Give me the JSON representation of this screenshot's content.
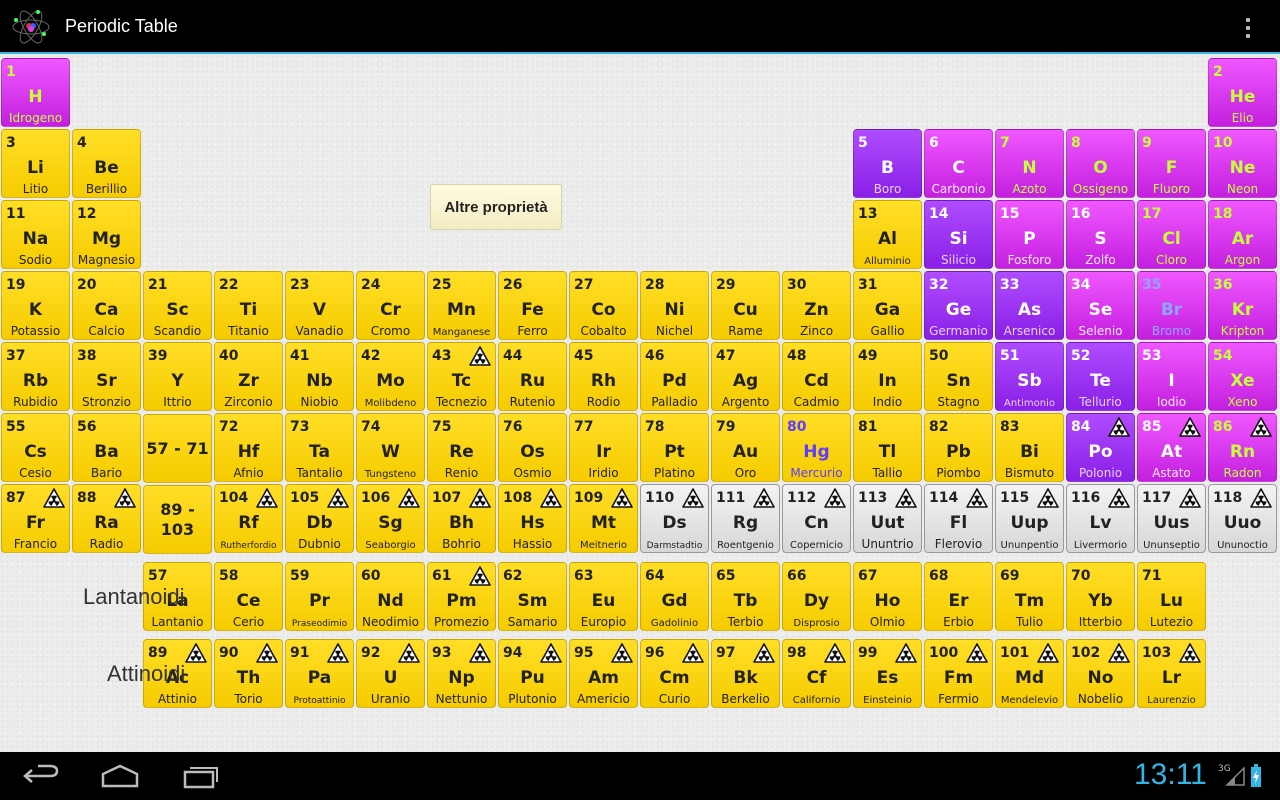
{
  "app": {
    "title": "Periodic Table",
    "icon": "atom-icon",
    "menu_icon": "overflow-menu-icon"
  },
  "colors": {
    "metal": "#f8d200",
    "semimetal": "#9a30f0",
    "nonmetal": "#d93af0",
    "unknown": "#e0e0e0",
    "gas_text": "#c6ff3a",
    "liquid_text": "#5c3cff",
    "accent": "#33b5e5"
  },
  "buttons": {
    "more_properties": "Altre proprietà"
  },
  "series": {
    "lanthanides": "Lantanoidi",
    "actinides": "Attinoidi"
  },
  "ranges": {
    "lanthanides_range": "57 - 71",
    "actinides_range": "89 -\n103"
  },
  "elements": [
    {
      "n": "1",
      "s": "H",
      "name": "Idrogeno",
      "cat": "nonm",
      "state": "gas"
    },
    {
      "n": "2",
      "s": "He",
      "name": "Elio",
      "cat": "nonm",
      "state": "gas"
    },
    {
      "n": "3",
      "s": "Li",
      "name": "Litio",
      "cat": "metal"
    },
    {
      "n": "4",
      "s": "Be",
      "name": "Berillio",
      "cat": "metal"
    },
    {
      "n": "5",
      "s": "B",
      "name": "Boro",
      "cat": "semi"
    },
    {
      "n": "6",
      "s": "C",
      "name": "Carbonio",
      "cat": "nonm"
    },
    {
      "n": "7",
      "s": "N",
      "name": "Azoto",
      "cat": "nonm",
      "state": "gas"
    },
    {
      "n": "8",
      "s": "O",
      "name": "Ossigeno",
      "cat": "nonm",
      "state": "gas"
    },
    {
      "n": "9",
      "s": "F",
      "name": "Fluoro",
      "cat": "nonm",
      "state": "gas"
    },
    {
      "n": "10",
      "s": "Ne",
      "name": "Neon",
      "cat": "nonm",
      "state": "gas"
    },
    {
      "n": "11",
      "s": "Na",
      "name": "Sodio",
      "cat": "metal"
    },
    {
      "n": "12",
      "s": "Mg",
      "name": "Magnesio",
      "cat": "metal"
    },
    {
      "n": "13",
      "s": "Al",
      "name": "Alluminio",
      "cat": "metal"
    },
    {
      "n": "14",
      "s": "Si",
      "name": "Silicio",
      "cat": "semi"
    },
    {
      "n": "15",
      "s": "P",
      "name": "Fosforo",
      "cat": "nonm"
    },
    {
      "n": "16",
      "s": "S",
      "name": "Zolfo",
      "cat": "nonm"
    },
    {
      "n": "17",
      "s": "Cl",
      "name": "Cloro",
      "cat": "nonm",
      "state": "gas"
    },
    {
      "n": "18",
      "s": "Ar",
      "name": "Argon",
      "cat": "nonm",
      "state": "gas"
    },
    {
      "n": "19",
      "s": "K",
      "name": "Potassio",
      "cat": "metal"
    },
    {
      "n": "20",
      "s": "Ca",
      "name": "Calcio",
      "cat": "metal"
    },
    {
      "n": "21",
      "s": "Sc",
      "name": "Scandio",
      "cat": "metal"
    },
    {
      "n": "22",
      "s": "Ti",
      "name": "Titanio",
      "cat": "metal"
    },
    {
      "n": "23",
      "s": "V",
      "name": "Vanadio",
      "cat": "metal"
    },
    {
      "n": "24",
      "s": "Cr",
      "name": "Cromo",
      "cat": "metal"
    },
    {
      "n": "25",
      "s": "Mn",
      "name": "Manganese",
      "cat": "metal"
    },
    {
      "n": "26",
      "s": "Fe",
      "name": "Ferro",
      "cat": "metal"
    },
    {
      "n": "27",
      "s": "Co",
      "name": "Cobalto",
      "cat": "metal"
    },
    {
      "n": "28",
      "s": "Ni",
      "name": "Nichel",
      "cat": "metal"
    },
    {
      "n": "29",
      "s": "Cu",
      "name": "Rame",
      "cat": "metal"
    },
    {
      "n": "30",
      "s": "Zn",
      "name": "Zinco",
      "cat": "metal"
    },
    {
      "n": "31",
      "s": "Ga",
      "name": "Gallio",
      "cat": "metal"
    },
    {
      "n": "32",
      "s": "Ge",
      "name": "Germanio",
      "cat": "semi"
    },
    {
      "n": "33",
      "s": "As",
      "name": "Arsenico",
      "cat": "semi"
    },
    {
      "n": "34",
      "s": "Se",
      "name": "Selenio",
      "cat": "nonm"
    },
    {
      "n": "35",
      "s": "Br",
      "name": "Bromo",
      "cat": "nonm",
      "state": "liquid"
    },
    {
      "n": "36",
      "s": "Kr",
      "name": "Kripton",
      "cat": "nonm",
      "state": "gas"
    },
    {
      "n": "37",
      "s": "Rb",
      "name": "Rubidio",
      "cat": "metal"
    },
    {
      "n": "38",
      "s": "Sr",
      "name": "Stronzio",
      "cat": "metal"
    },
    {
      "n": "39",
      "s": "Y",
      "name": "Ittrio",
      "cat": "metal"
    },
    {
      "n": "40",
      "s": "Zr",
      "name": "Zirconio",
      "cat": "metal"
    },
    {
      "n": "41",
      "s": "Nb",
      "name": "Niobio",
      "cat": "metal"
    },
    {
      "n": "42",
      "s": "Mo",
      "name": "Molibdeno",
      "cat": "metal"
    },
    {
      "n": "43",
      "s": "Tc",
      "name": "Tecnezio",
      "cat": "metal",
      "rad": true
    },
    {
      "n": "44",
      "s": "Ru",
      "name": "Rutenio",
      "cat": "metal"
    },
    {
      "n": "45",
      "s": "Rh",
      "name": "Rodio",
      "cat": "metal"
    },
    {
      "n": "46",
      "s": "Pd",
      "name": "Palladio",
      "cat": "metal"
    },
    {
      "n": "47",
      "s": "Ag",
      "name": "Argento",
      "cat": "metal"
    },
    {
      "n": "48",
      "s": "Cd",
      "name": "Cadmio",
      "cat": "metal"
    },
    {
      "n": "49",
      "s": "In",
      "name": "Indio",
      "cat": "metal"
    },
    {
      "n": "50",
      "s": "Sn",
      "name": "Stagno",
      "cat": "metal"
    },
    {
      "n": "51",
      "s": "Sb",
      "name": "Antimonio",
      "cat": "semi"
    },
    {
      "n": "52",
      "s": "Te",
      "name": "Tellurio",
      "cat": "semi"
    },
    {
      "n": "53",
      "s": "I",
      "name": "Iodio",
      "cat": "nonm"
    },
    {
      "n": "54",
      "s": "Xe",
      "name": "Xeno",
      "cat": "nonm",
      "state": "gas"
    },
    {
      "n": "55",
      "s": "Cs",
      "name": "Cesio",
      "cat": "metal"
    },
    {
      "n": "56",
      "s": "Ba",
      "name": "Bario",
      "cat": "metal"
    },
    {
      "n": "72",
      "s": "Hf",
      "name": "Afnio",
      "cat": "metal"
    },
    {
      "n": "73",
      "s": "Ta",
      "name": "Tantalio",
      "cat": "metal"
    },
    {
      "n": "74",
      "s": "W",
      "name": "Tungsteno",
      "cat": "metal"
    },
    {
      "n": "75",
      "s": "Re",
      "name": "Renio",
      "cat": "metal"
    },
    {
      "n": "76",
      "s": "Os",
      "name": "Osmio",
      "cat": "metal"
    },
    {
      "n": "77",
      "s": "Ir",
      "name": "Iridio",
      "cat": "metal"
    },
    {
      "n": "78",
      "s": "Pt",
      "name": "Platino",
      "cat": "metal"
    },
    {
      "n": "79",
      "s": "Au",
      "name": "Oro",
      "cat": "metal"
    },
    {
      "n": "80",
      "s": "Hg",
      "name": "Mercurio",
      "cat": "metal",
      "state": "liquid"
    },
    {
      "n": "81",
      "s": "Tl",
      "name": "Tallio",
      "cat": "metal"
    },
    {
      "n": "82",
      "s": "Pb",
      "name": "Piombo",
      "cat": "metal"
    },
    {
      "n": "83",
      "s": "Bi",
      "name": "Bismuto",
      "cat": "metal"
    },
    {
      "n": "84",
      "s": "Po",
      "name": "Polonio",
      "cat": "semi",
      "rad": true
    },
    {
      "n": "85",
      "s": "At",
      "name": "Astato",
      "cat": "nonm",
      "rad": true
    },
    {
      "n": "86",
      "s": "Rn",
      "name": "Radon",
      "cat": "nonm",
      "state": "gas",
      "rad": true
    },
    {
      "n": "87",
      "s": "Fr",
      "name": "Francio",
      "cat": "metal",
      "rad": true
    },
    {
      "n": "88",
      "s": "Ra",
      "name": "Radio",
      "cat": "metal",
      "rad": true
    },
    {
      "n": "104",
      "s": "Rf",
      "name": "Rutherfordio",
      "cat": "metal",
      "rad": true
    },
    {
      "n": "105",
      "s": "Db",
      "name": "Dubnio",
      "cat": "metal",
      "rad": true
    },
    {
      "n": "106",
      "s": "Sg",
      "name": "Seaborgio",
      "cat": "metal",
      "rad": true
    },
    {
      "n": "107",
      "s": "Bh",
      "name": "Bohrio",
      "cat": "metal",
      "rad": true
    },
    {
      "n": "108",
      "s": "Hs",
      "name": "Hassio",
      "cat": "metal",
      "rad": true
    },
    {
      "n": "109",
      "s": "Mt",
      "name": "Meitnerio",
      "cat": "metal",
      "rad": true
    },
    {
      "n": "110",
      "s": "Ds",
      "name": "Darmstadtio",
      "cat": "unk",
      "rad": true
    },
    {
      "n": "111",
      "s": "Rg",
      "name": "Roentgenio",
      "cat": "unk",
      "rad": true
    },
    {
      "n": "112",
      "s": "Cn",
      "name": "Copernicio",
      "cat": "unk",
      "rad": true
    },
    {
      "n": "113",
      "s": "Uut",
      "name": "Ununtrio",
      "cat": "unk",
      "rad": true
    },
    {
      "n": "114",
      "s": "Fl",
      "name": "Flerovio",
      "cat": "unk",
      "rad": true
    },
    {
      "n": "115",
      "s": "Uup",
      "name": "Ununpentio",
      "cat": "unk",
      "rad": true
    },
    {
      "n": "116",
      "s": "Lv",
      "name": "Livermorio",
      "cat": "unk",
      "rad": true
    },
    {
      "n": "117",
      "s": "Uus",
      "name": "Ununseptio",
      "cat": "unk",
      "rad": true
    },
    {
      "n": "118",
      "s": "Uuo",
      "name": "Ununoctio",
      "cat": "unk",
      "rad": true
    },
    {
      "n": "57",
      "s": "La",
      "name": "Lantanio",
      "cat": "metal"
    },
    {
      "n": "58",
      "s": "Ce",
      "name": "Cerio",
      "cat": "metal"
    },
    {
      "n": "59",
      "s": "Pr",
      "name": "Praseodimio",
      "cat": "metal"
    },
    {
      "n": "60",
      "s": "Nd",
      "name": "Neodimio",
      "cat": "metal"
    },
    {
      "n": "61",
      "s": "Pm",
      "name": "Promezio",
      "cat": "metal",
      "rad": true
    },
    {
      "n": "62",
      "s": "Sm",
      "name": "Samario",
      "cat": "metal"
    },
    {
      "n": "63",
      "s": "Eu",
      "name": "Europio",
      "cat": "metal"
    },
    {
      "n": "64",
      "s": "Gd",
      "name": "Gadolinio",
      "cat": "metal"
    },
    {
      "n": "65",
      "s": "Tb",
      "name": "Terbio",
      "cat": "metal"
    },
    {
      "n": "66",
      "s": "Dy",
      "name": "Disprosio",
      "cat": "metal"
    },
    {
      "n": "67",
      "s": "Ho",
      "name": "Olmio",
      "cat": "metal"
    },
    {
      "n": "68",
      "s": "Er",
      "name": "Erbio",
      "cat": "metal"
    },
    {
      "n": "69",
      "s": "Tm",
      "name": "Tulio",
      "cat": "metal"
    },
    {
      "n": "70",
      "s": "Yb",
      "name": "Itterbio",
      "cat": "metal"
    },
    {
      "n": "71",
      "s": "Lu",
      "name": "Lutezio",
      "cat": "metal"
    },
    {
      "n": "89",
      "s": "Ac",
      "name": "Attinio",
      "cat": "metal",
      "rad": true
    },
    {
      "n": "90",
      "s": "Th",
      "name": "Torio",
      "cat": "metal",
      "rad": true
    },
    {
      "n": "91",
      "s": "Pa",
      "name": "Protoattinio",
      "cat": "metal",
      "rad": true
    },
    {
      "n": "92",
      "s": "U",
      "name": "Uranio",
      "cat": "metal",
      "rad": true
    },
    {
      "n": "93",
      "s": "Np",
      "name": "Nettunio",
      "cat": "metal",
      "rad": true
    },
    {
      "n": "94",
      "s": "Pu",
      "name": "Plutonio",
      "cat": "metal",
      "rad": true
    },
    {
      "n": "95",
      "s": "Am",
      "name": "Americio",
      "cat": "metal",
      "rad": true
    },
    {
      "n": "96",
      "s": "Cm",
      "name": "Curio",
      "cat": "metal",
      "rad": true
    },
    {
      "n": "97",
      "s": "Bk",
      "name": "Berkelio",
      "cat": "metal",
      "rad": true
    },
    {
      "n": "98",
      "s": "Cf",
      "name": "Californio",
      "cat": "metal",
      "rad": true
    },
    {
      "n": "99",
      "s": "Es",
      "name": "Einsteinio",
      "cat": "metal",
      "rad": true
    },
    {
      "n": "100",
      "s": "Fm",
      "name": "Fermio",
      "cat": "metal",
      "rad": true
    },
    {
      "n": "101",
      "s": "Md",
      "name": "Mendelevio",
      "cat": "metal",
      "rad": true
    },
    {
      "n": "102",
      "s": "No",
      "name": "Nobelio",
      "cat": "metal",
      "rad": true
    },
    {
      "n": "103",
      "s": "Lr",
      "name": "Laurenzio",
      "cat": "metal",
      "rad": true
    }
  ],
  "navbar": {
    "back_icon": "back-icon",
    "home_icon": "home-icon",
    "recents_icon": "recent-apps-icon"
  },
  "status": {
    "time": "13:11",
    "network": "3G",
    "signal_icon": "signal-icon",
    "battery_icon": "battery-charging-icon"
  }
}
